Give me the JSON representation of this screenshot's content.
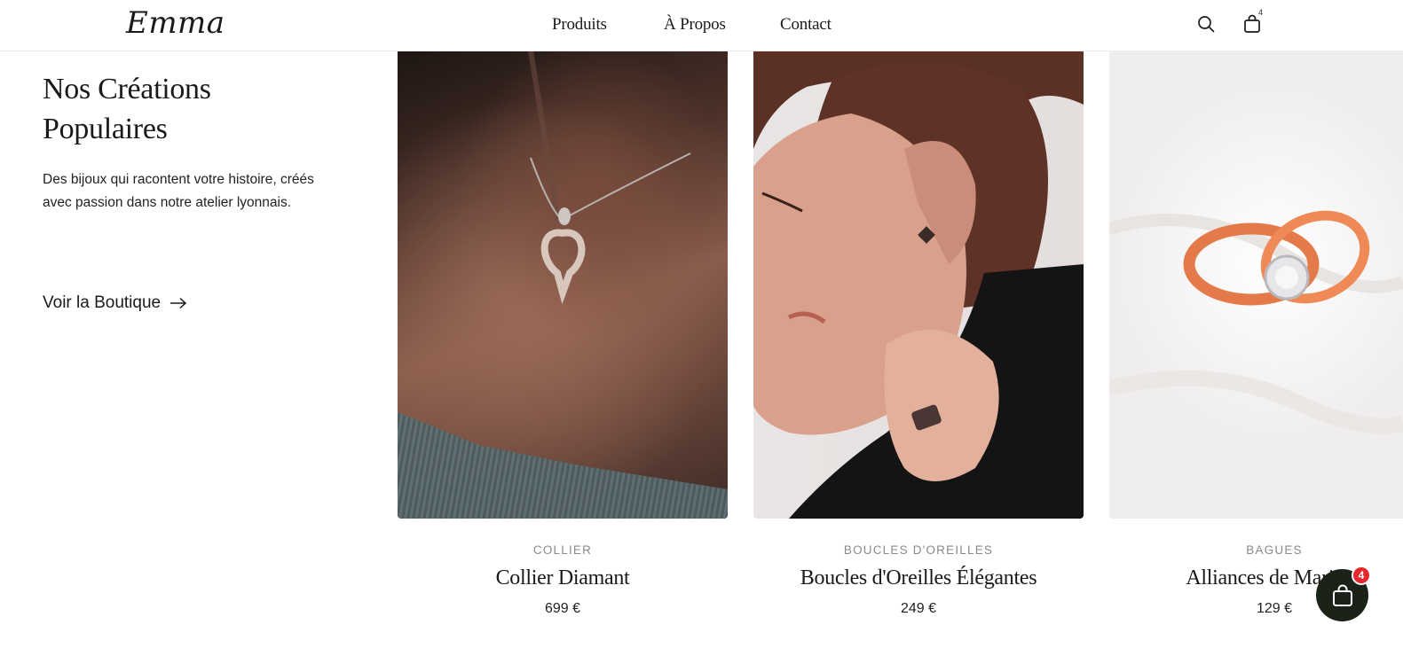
{
  "header": {
    "logo": "Emma",
    "nav": [
      "Produits",
      "À Propos",
      "Contact"
    ],
    "bag_count": "4"
  },
  "intro": {
    "title_line1": "Nos Créations",
    "title_line2": "Populaires",
    "description": "Des bijoux qui racontent votre histoire, créés avec passion dans notre atelier lyonnais.",
    "link": "Voir la Boutique"
  },
  "products": [
    {
      "category": "COLLIER",
      "name": "Collier Diamant",
      "price": "699 €"
    },
    {
      "category": "BOUCLES D'OREILLES",
      "name": "Boucles d'Oreilles Élégantes",
      "price": "249 €"
    },
    {
      "category": "BAGUES",
      "name": "Alliances de Mariage",
      "price": "129 €"
    }
  ],
  "floating_cart": {
    "count": "4"
  },
  "colors": {
    "accent_dark": "#1b2218",
    "badge": "#e5262d",
    "text": "#1a1a1a",
    "muted": "#8a8a8a"
  }
}
